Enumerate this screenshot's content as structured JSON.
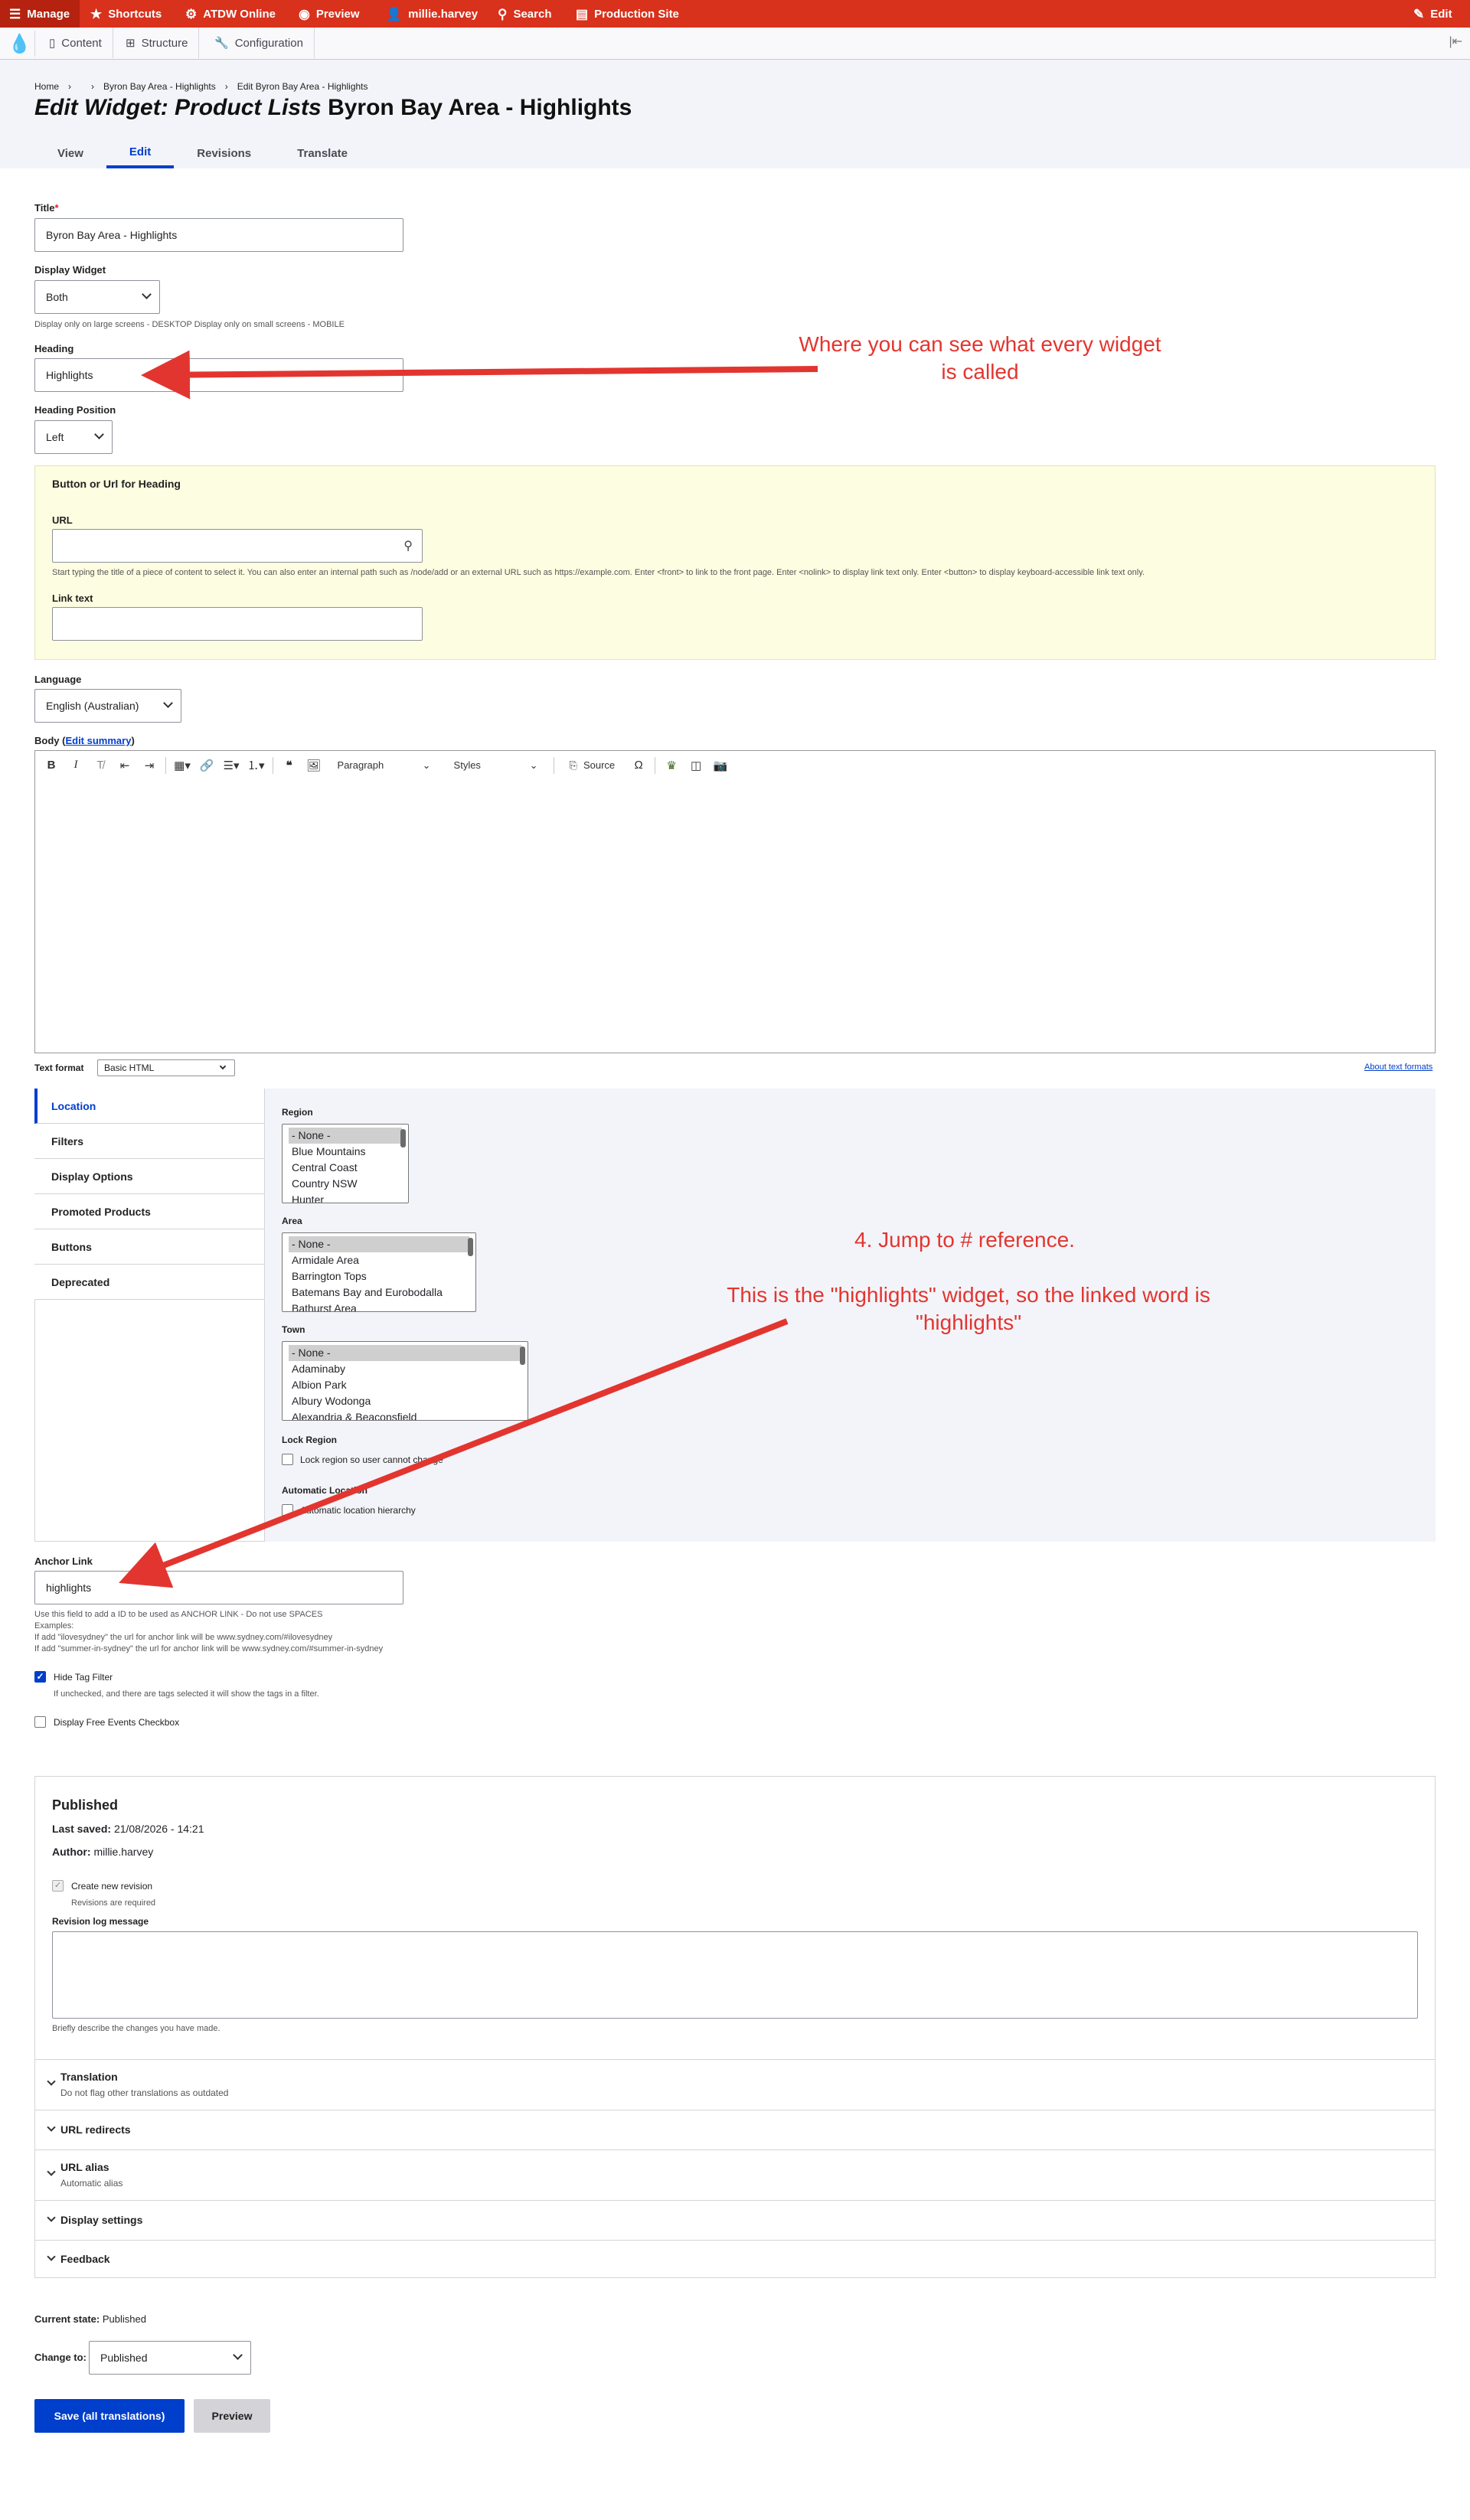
{
  "toolbar": {
    "manage": "Manage",
    "shortcuts": "Shortcuts",
    "atdw": "ATDW Online",
    "preview": "Preview",
    "user": "millie.harvey",
    "search": "Search",
    "production": "Production Site",
    "edit": "Edit"
  },
  "tray": {
    "content": "Content",
    "structure": "Structure",
    "configuration": "Configuration"
  },
  "breadcrumb": [
    "Home",
    "›",
    "›",
    "Byron Bay Area - Highlights",
    "›",
    "Edit Byron Bay Area - Highlights"
  ],
  "page": {
    "title_prefix": "Edit Widget: Product Lists",
    "title_rest": " Byron Bay Area - Highlights"
  },
  "tabs": [
    "View",
    "Edit",
    "Revisions",
    "Translate"
  ],
  "form": {
    "title_label": "Title",
    "title_value": "Byron Bay Area - Highlights",
    "display_widget_label": "Display Widget",
    "display_widget_value": "Both",
    "display_widget_desc": "Display only on large screens - DESKTOP Display only on small screens - MOBILE",
    "heading_label": "Heading",
    "heading_value": "Highlights",
    "heading_position_label": "Heading Position",
    "heading_position_value": "Left",
    "button_section_title": "Button or Url for Heading",
    "url_label": "URL",
    "url_desc": "Start typing the title of a piece of content to select it. You can also enter an internal path such as /node/add or an external URL such as https://example.com. Enter <front> to link to the front page. Enter <nolink> to display link text only. Enter <button> to display keyboard-accessible link text only.",
    "link_text_label": "Link text",
    "language_label": "Language",
    "language_value": "English (Australian)",
    "body_label": "Body (",
    "body_link": "Edit summary",
    "body_label_end": ")",
    "text_format_label": "Text format",
    "text_format_value": "Basic HTML",
    "about_formats": "About text formats"
  },
  "editor": {
    "paragraph": "Paragraph",
    "styles": "Styles",
    "source": "Source"
  },
  "vertical_tabs": [
    "Location",
    "Filters",
    "Display Options",
    "Promoted Products",
    "Buttons",
    "Deprecated"
  ],
  "location": {
    "region_label": "Region",
    "region_options": [
      "- None -",
      "Blue Mountains",
      "Central Coast",
      "Country NSW",
      "Hunter"
    ],
    "area_label": "Area",
    "area_options": [
      "- None -",
      "Armidale Area",
      "Barrington Tops",
      "Batemans Bay and Eurobodalla",
      "Bathurst Area"
    ],
    "town_label": "Town",
    "town_options": [
      "- None -",
      "Adaminaby",
      "Albion Park",
      "Albury Wodonga",
      "Alexandria & Beaconsfield"
    ],
    "lock_region_label": "Lock Region",
    "lock_region_cb": "Lock region so user cannot change",
    "auto_location_label": "Automatic Location",
    "auto_location_cb": "Automatic location hierarchy"
  },
  "anchor": {
    "label": "Anchor Link",
    "value": "highlights",
    "desc1": "Use this field to add a ID to be used as ANCHOR LINK - Do not use SPACES",
    "desc2": "Examples:",
    "desc3": "If add \"ilovesydney\" the url for anchor link will be www.sydney.com/#ilovesydney",
    "desc4": "If add \"summer-in-sydney\" the url for anchor link will be www.sydney.com/#summer-in-sydney"
  },
  "hide_tag": {
    "label": "Hide Tag Filter",
    "desc": "If unchecked, and there are tags selected it will show the tags in a filter."
  },
  "free_events": {
    "label": "Display Free Events Checkbox"
  },
  "publish": {
    "status": "Published",
    "last_saved_label": "Last saved:",
    "last_saved_value": "21/08/2026 - 14:21",
    "author_label": "Author:",
    "author_value": "millie.harvey",
    "new_revision": "Create new revision",
    "revisions_required": "Revisions are required",
    "revision_log_label": "Revision log message",
    "revision_log_desc": "Briefly describe the changes you have made."
  },
  "accordions": [
    {
      "title": "Translation",
      "sub": "Do not flag other translations as outdated"
    },
    {
      "title": "URL redirects",
      "sub": ""
    },
    {
      "title": "URL alias",
      "sub": "Automatic alias"
    },
    {
      "title": "Display settings",
      "sub": ""
    },
    {
      "title": "Feedback",
      "sub": ""
    }
  ],
  "moderation": {
    "current_state_label": "Current state:",
    "current_state_value": "Published",
    "change_to_label": "Change to:",
    "change_to_value": "Published"
  },
  "buttons": {
    "save": "Save (all translations)",
    "preview": "Preview"
  },
  "annotations": {
    "heading_note": "Where you can see what every widget is called",
    "jump_note": "4. Jump to # reference.",
    "highlights_note": "This is the \"highlights\" widget, so the linked word is \"highlights\""
  },
  "colors": {
    "toolbar": "#d8311c",
    "accent": "#003ecc",
    "annotation": "#e3352f"
  }
}
